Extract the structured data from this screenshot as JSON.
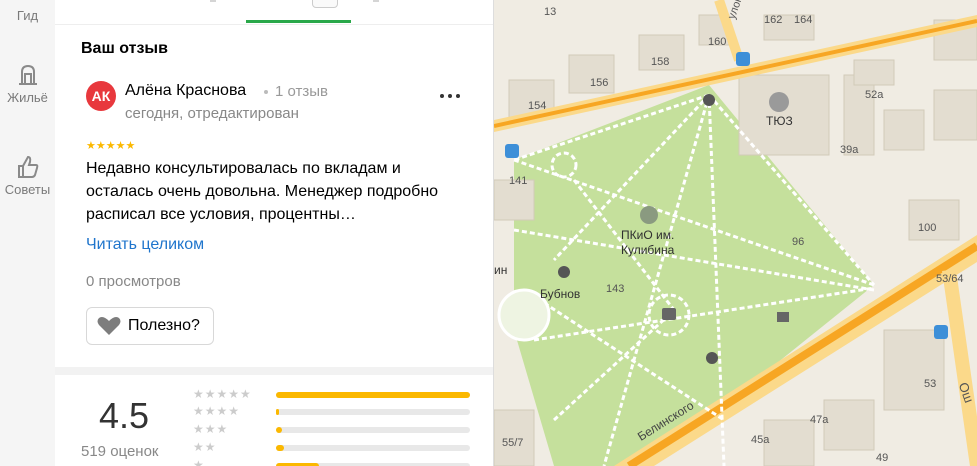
{
  "sidebar": {
    "items": [
      {
        "label": "Гид",
        "icon": "guide-icon"
      },
      {
        "label": "Жильё",
        "icon": "housing-icon"
      },
      {
        "label": "Советы",
        "icon": "thumbs-up-icon"
      }
    ]
  },
  "review": {
    "section_title": "Ваш отзыв",
    "avatar_initials": "АК",
    "author": "Алёна Краснова",
    "author_reviews": "1 отзыв",
    "date": "сегодня, отредактирован",
    "stars": "★★★★★",
    "rating": 5,
    "text": "Недавно консультировалась по вкладам и осталась очень довольна. Менеджер подробно расписал все условия, процентны…",
    "read_more": "Читать целиком",
    "views": "0 просмотров",
    "useful_label": "Полезно?"
  },
  "summary": {
    "rating": "4.5",
    "count": "519 оценок",
    "rows": [
      {
        "stars": "★★★★★",
        "fraction": 1.0
      },
      {
        "stars": "★★★★",
        "fraction": 0.015
      },
      {
        "stars": "★★★",
        "fraction": 0.03
      },
      {
        "stars": "★★",
        "fraction": 0.04
      },
      {
        "stars": "★",
        "fraction": 0.22
      }
    ]
  },
  "map": {
    "labels": {
      "park": "ПКиО им.\nКулибина",
      "tuz": "ТЮЗ",
      "bubnov": "Бубнов",
      "street_belinsky": "Белинского",
      "street_pereulok": "улок",
      "street_osh": "Ош",
      "n13": "13",
      "n162": "162",
      "n164": "164",
      "n160": "160",
      "n158": "158",
      "n156": "156",
      "n154": "154",
      "n52a": "52а",
      "n39a": "39а",
      "n141": "141",
      "n96": "96",
      "n100": "100",
      "n5364": "53/64",
      "n143": "143",
      "n53": "53",
      "n47a": "47а",
      "n45a": "45а",
      "n557": "55/7",
      "n49": "49",
      "min": "ин"
    },
    "colors": {
      "park": "#c5e09c",
      "road": "#f7a623",
      "building": "#e3ddd0"
    }
  }
}
